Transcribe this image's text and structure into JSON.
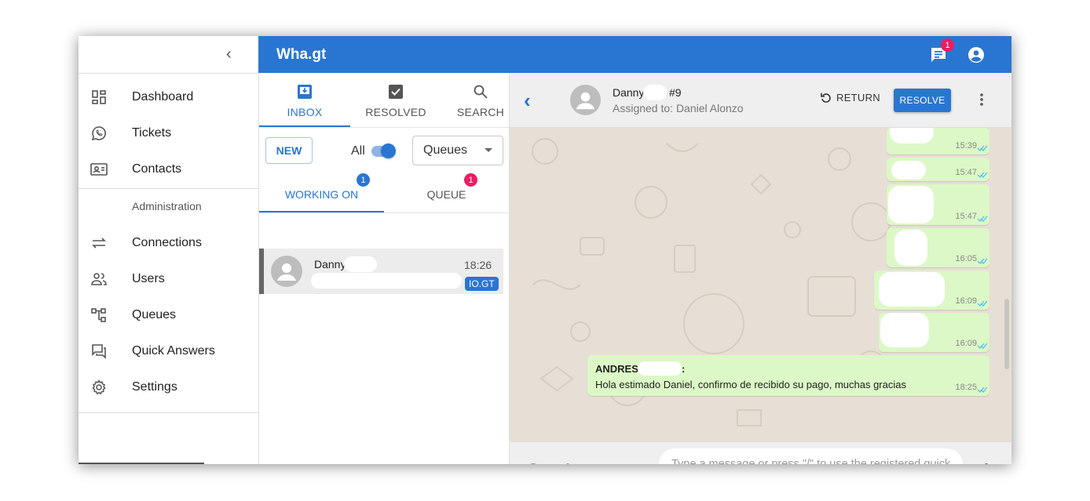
{
  "app": {
    "brand": "Wha.gt",
    "notification_count": "1",
    "accent": "#2976d2",
    "badge_color": "#e91e63"
  },
  "sidebar": {
    "items": [
      {
        "label": "Dashboard",
        "icon": "dashboard-icon"
      },
      {
        "label": "Tickets",
        "icon": "whatsapp-icon"
      },
      {
        "label": "Contacts",
        "icon": "contact-card-icon"
      },
      {
        "label": "Connections",
        "icon": "sync-alt-icon"
      },
      {
        "label": "Users",
        "icon": "people-icon"
      },
      {
        "label": "Queues",
        "icon": "account-tree-icon"
      },
      {
        "label": "Quick Answers",
        "icon": "question-answer-icon"
      },
      {
        "label": "Settings",
        "icon": "gear-icon"
      }
    ],
    "section_header": "Administration"
  },
  "tickets": {
    "tabs": [
      {
        "label": "INBOX",
        "icon": "inbox-icon"
      },
      {
        "label": "RESOLVED",
        "icon": "check-box-icon"
      },
      {
        "label": "SEARCH",
        "icon": "search-icon"
      }
    ],
    "new_label": "NEW",
    "all_label": "All",
    "all_toggle_on": true,
    "queues_select": "Queues",
    "subtabs": [
      {
        "label": "WORKING ON",
        "badge": "1"
      },
      {
        "label": "QUEUE",
        "badge": "1"
      }
    ],
    "list": [
      {
        "name": "Danny",
        "time": "18:26",
        "tag": "IO.GT"
      }
    ]
  },
  "chat": {
    "contact_name": "Danny",
    "ticket_number": "#9",
    "assigned": "Assigned to: Daniel Alonzo",
    "return_label": "RETURN",
    "resolve_label": "RESOLVE",
    "messages": [
      {
        "time": "15:39"
      },
      {
        "time": "15:47"
      },
      {
        "time": "15:47"
      },
      {
        "time": "16:05"
      },
      {
        "time": "16:09"
      },
      {
        "time": "16:09"
      },
      {
        "sender": "ANDRES",
        "sender_suffix": ":",
        "text": "Hola estimado Daniel, confirmo de recibido su pago, muchas gracias",
        "time": "18:25"
      }
    ],
    "input_placeholder": "Type a message or press \"/\" to use the registered quick responses"
  }
}
